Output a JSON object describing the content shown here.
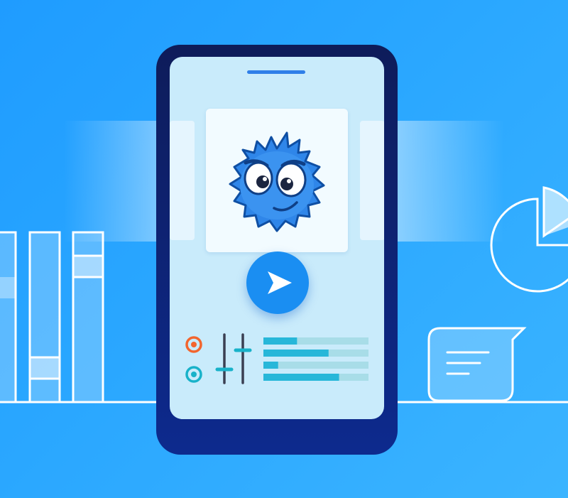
{
  "colors": {
    "background": "#2aa7ff",
    "phone_body": "#0d2a8e",
    "screen": "#c9ebfb",
    "accent_blue": "#1a8ef2",
    "mascot_blue": "#2f86e9",
    "radio_orange": "#f2652e",
    "radio_teal": "#18b2c9",
    "bar_fill": "#27b7d9",
    "bar_track": "#a8dde8"
  },
  "icons": {
    "mascot": "blue-fuzzy-mascot-icon",
    "send": "send-arrow-icon",
    "radio_1": "radio-icon",
    "radio_2": "radio-icon",
    "sliders": "sliders-icon",
    "pie_chart": "pie-chart-icon",
    "chat": "chat-bubble-icon",
    "bars": "vertical-bars-icon"
  },
  "progress_bars": [
    0.32,
    0.62,
    0.14,
    0.72
  ],
  "slider_levels": [
    0.3,
    0.55
  ]
}
